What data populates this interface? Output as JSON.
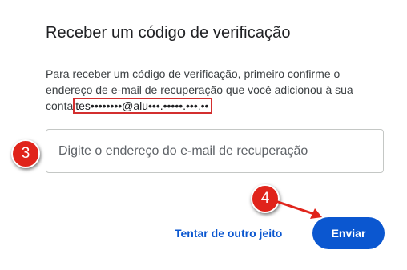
{
  "page": {
    "title": "Receber um código de verificação",
    "description_line1": "Para receber um código de verificação, primeiro confirme o",
    "description_line2": "endereço de e-mail de recuperação que você adicionou à sua",
    "description_line3_prefix": "conta",
    "masked_email": "tes••••••••@alu•••.•••••.•••.••"
  },
  "form": {
    "email_placeholder": "Digite o endereço do e-mail de recuperação",
    "email_value": ""
  },
  "actions": {
    "try_another_label": "Tentar de outro jeito",
    "send_label": "Enviar"
  },
  "annotations": {
    "step_3": "3",
    "step_4": "4",
    "highlight_color": "#d32f2f",
    "badge_color": "#e0241b"
  },
  "colors": {
    "accent": "#0b57d0",
    "text": "#202124"
  }
}
